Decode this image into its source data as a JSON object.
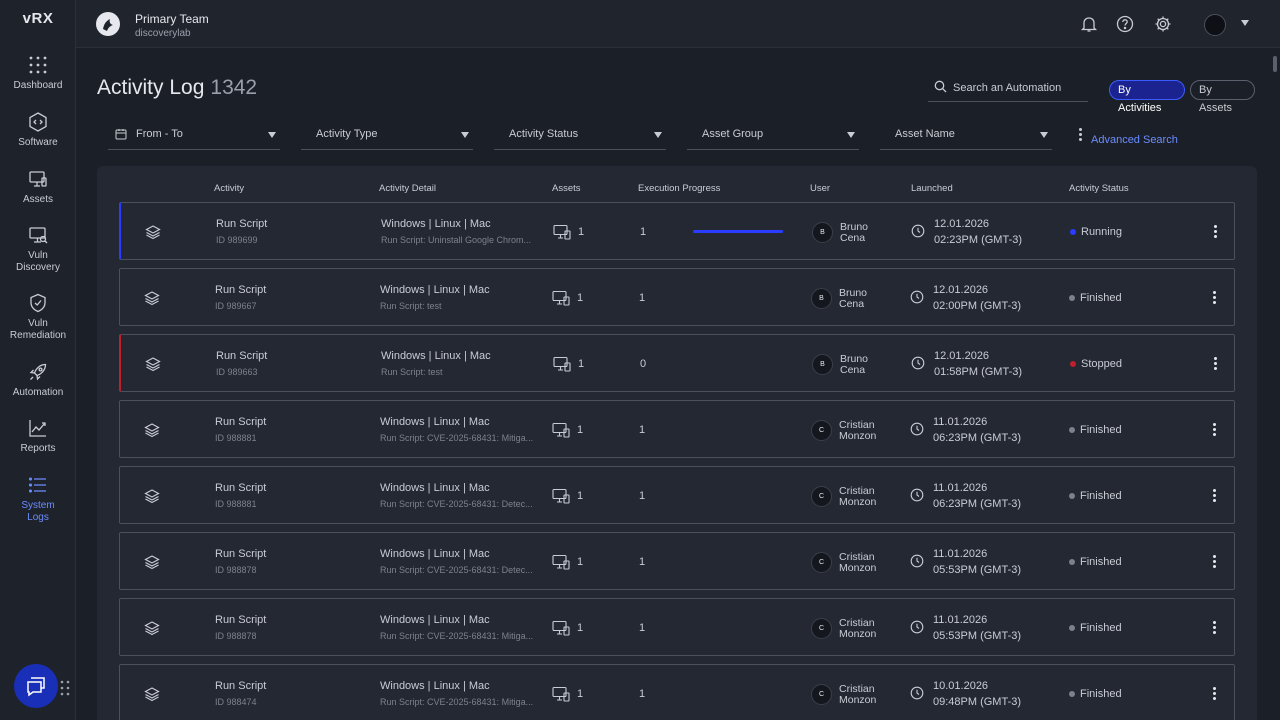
{
  "sidebar": {
    "logo": "vRX",
    "items": [
      {
        "label_1": "Dashboard",
        "label_2": "",
        "icon": "grid-icon"
      },
      {
        "label_1": "Software",
        "label_2": "",
        "icon": "code-icon"
      },
      {
        "label_1": "Assets",
        "label_2": "",
        "icon": "monitor-icon"
      },
      {
        "label_1": "Vuln",
        "label_2": "Discovery",
        "icon": "search-monitor-icon"
      },
      {
        "label_1": "Vuln",
        "label_2": "Remediation",
        "icon": "shield-icon"
      },
      {
        "label_1": "Automation",
        "label_2": "",
        "icon": "rocket-icon"
      },
      {
        "label_1": "Reports",
        "label_2": "",
        "icon": "chart-icon"
      },
      {
        "label_1": "System",
        "label_2": "Logs",
        "icon": "list-icon"
      }
    ],
    "active_color": "#6b8cff"
  },
  "header": {
    "team": "Primary Team",
    "org": "discoverylab"
  },
  "page": {
    "title": "Activity Log",
    "count": "1342",
    "search_placeholder": "Search an Automation",
    "toggle_on": "By Activities",
    "toggle_off": "By Assets"
  },
  "filters": {
    "items": [
      "From - To",
      "Activity Type",
      "Activity Status",
      "Asset Group",
      "Asset Name"
    ],
    "advanced": "Advanced Search"
  },
  "table": {
    "columns": [
      "Activity",
      "Activity Detail",
      "Assets",
      "Execution Progress",
      "User",
      "Launched",
      "Activity Status"
    ],
    "rows": [
      {
        "activity": "Run Script",
        "id": "ID 989699",
        "detail": "Windows | Linux | Mac",
        "sub": "Run Script: Uninstall Google Chrom...",
        "assets": "1",
        "exec": "1",
        "progress": 1.0,
        "initial": "B",
        "user_first": "Bruno",
        "user_last": "Cena",
        "date": "12.01.2026",
        "time": "02:23PM (GMT-3)",
        "status": "Running",
        "status_color": "#2a3cff",
        "accent": "blue"
      },
      {
        "activity": "Run Script",
        "id": "ID 989667",
        "detail": "Windows | Linux | Mac",
        "sub": "Run Script: test",
        "assets": "1",
        "exec": "1",
        "progress": 0,
        "initial": "B",
        "user_first": "Bruno",
        "user_last": "Cena",
        "date": "12.01.2026",
        "time": "02:00PM (GMT-3)",
        "status": "Finished",
        "status_color": "#7c828d",
        "accent": ""
      },
      {
        "activity": "Run Script",
        "id": "ID 989663",
        "detail": "Windows | Linux | Mac",
        "sub": "Run Script: test",
        "assets": "1",
        "exec": "0",
        "progress": 0,
        "initial": "B",
        "user_first": "Bruno",
        "user_last": "Cena",
        "date": "12.01.2026",
        "time": "01:58PM (GMT-3)",
        "status": "Stopped",
        "status_color": "#c0202a",
        "accent": "red"
      },
      {
        "activity": "Run Script",
        "id": "ID 988881",
        "detail": "Windows | Linux | Mac",
        "sub": "Run Script: CVE-2025-68431: Mitiga...",
        "assets": "1",
        "exec": "1",
        "progress": 0,
        "initial": "C",
        "user_first": "Cristian",
        "user_last": "Monzon",
        "date": "11.01.2026",
        "time": "06:23PM (GMT-3)",
        "status": "Finished",
        "status_color": "#7c828d",
        "accent": ""
      },
      {
        "activity": "Run Script",
        "id": "ID 988881",
        "detail": "Windows | Linux | Mac",
        "sub": "Run Script: CVE-2025-68431: Detec...",
        "assets": "1",
        "exec": "1",
        "progress": 0,
        "initial": "C",
        "user_first": "Cristian",
        "user_last": "Monzon",
        "date": "11.01.2026",
        "time": "06:23PM (GMT-3)",
        "status": "Finished",
        "status_color": "#7c828d",
        "accent": ""
      },
      {
        "activity": "Run Script",
        "id": "ID 988878",
        "detail": "Windows | Linux | Mac",
        "sub": "Run Script: CVE-2025-68431: Detec...",
        "assets": "1",
        "exec": "1",
        "progress": 0,
        "initial": "C",
        "user_first": "Cristian",
        "user_last": "Monzon",
        "date": "11.01.2026",
        "time": "05:53PM (GMT-3)",
        "status": "Finished",
        "status_color": "#7c828d",
        "accent": ""
      },
      {
        "activity": "Run Script",
        "id": "ID 988878",
        "detail": "Windows | Linux | Mac",
        "sub": "Run Script: CVE-2025-68431: Mitiga...",
        "assets": "1",
        "exec": "1",
        "progress": 0,
        "initial": "C",
        "user_first": "Cristian",
        "user_last": "Monzon",
        "date": "11.01.2026",
        "time": "05:53PM (GMT-3)",
        "status": "Finished",
        "status_color": "#7c828d",
        "accent": ""
      },
      {
        "activity": "Run Script",
        "id": "ID 988474",
        "detail": "Windows | Linux | Mac",
        "sub": "Run Script: CVE-2025-68431: Mitiga...",
        "assets": "1",
        "exec": "1",
        "progress": 0,
        "initial": "C",
        "user_first": "Cristian",
        "user_last": "Monzon",
        "date": "10.01.2026",
        "time": "09:48PM (GMT-3)",
        "status": "Finished",
        "status_color": "#7c828d",
        "accent": ""
      }
    ]
  }
}
